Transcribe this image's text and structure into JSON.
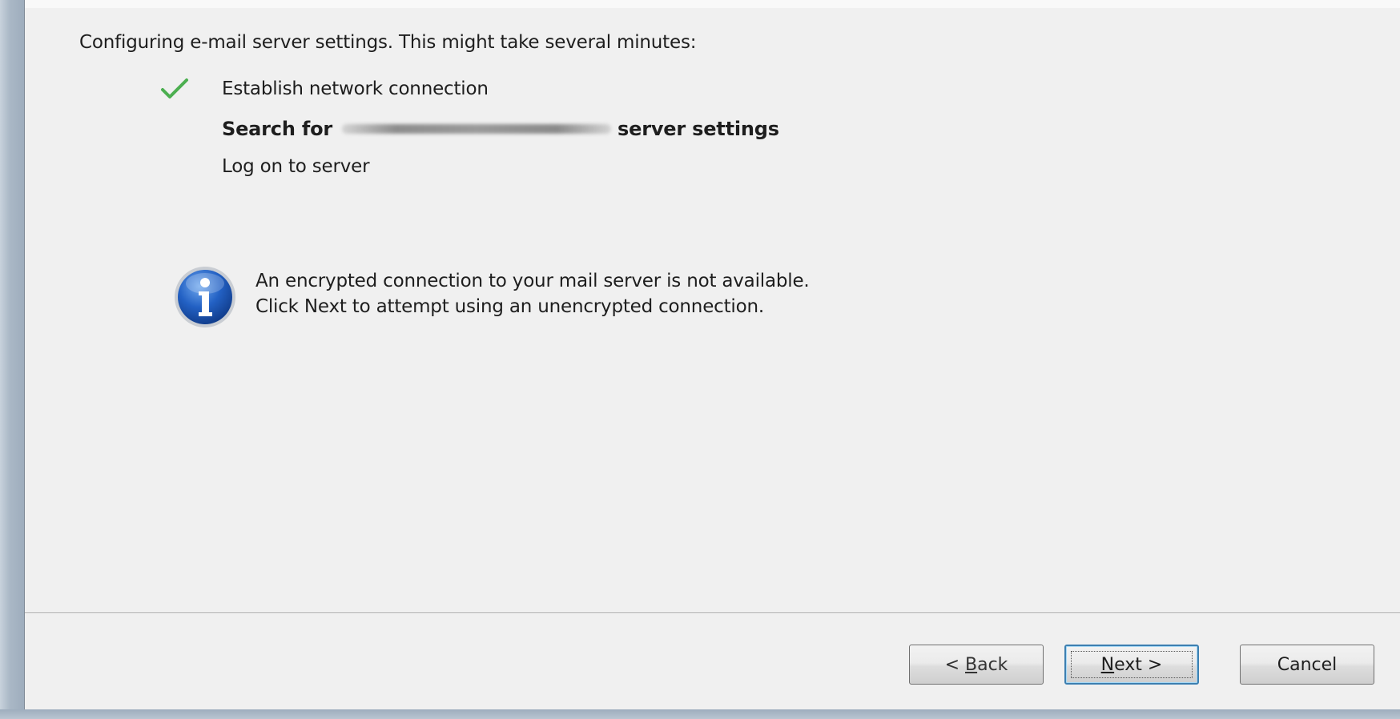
{
  "dialog": {
    "intro": "Configuring e-mail server settings. This might take several minutes:",
    "steps": [
      {
        "label": "Establish network connection",
        "status": "done"
      },
      {
        "prefix": "Search for",
        "redacted": true,
        "suffix": "server settings",
        "status": "in-progress"
      },
      {
        "label": "Log on to server",
        "status": "pending"
      }
    ],
    "info": {
      "line1": "An encrypted connection to your mail server is not available.",
      "line2": "Click Next to attempt using an unencrypted connection."
    }
  },
  "buttons": {
    "back": {
      "prefix": "< ",
      "mnemonic": "B",
      "rest": "ack"
    },
    "next": {
      "mnemonic": "N",
      "rest": "ext >"
    },
    "cancel": "Cancel"
  },
  "icons": {
    "step_done": "checkmark-icon",
    "info": "info-icon"
  },
  "colors": {
    "check": "#4caf50",
    "info_blue": "#1f5fb8",
    "focus_border": "#3c7fb1",
    "dialog_bg": "#f0f0f0"
  }
}
